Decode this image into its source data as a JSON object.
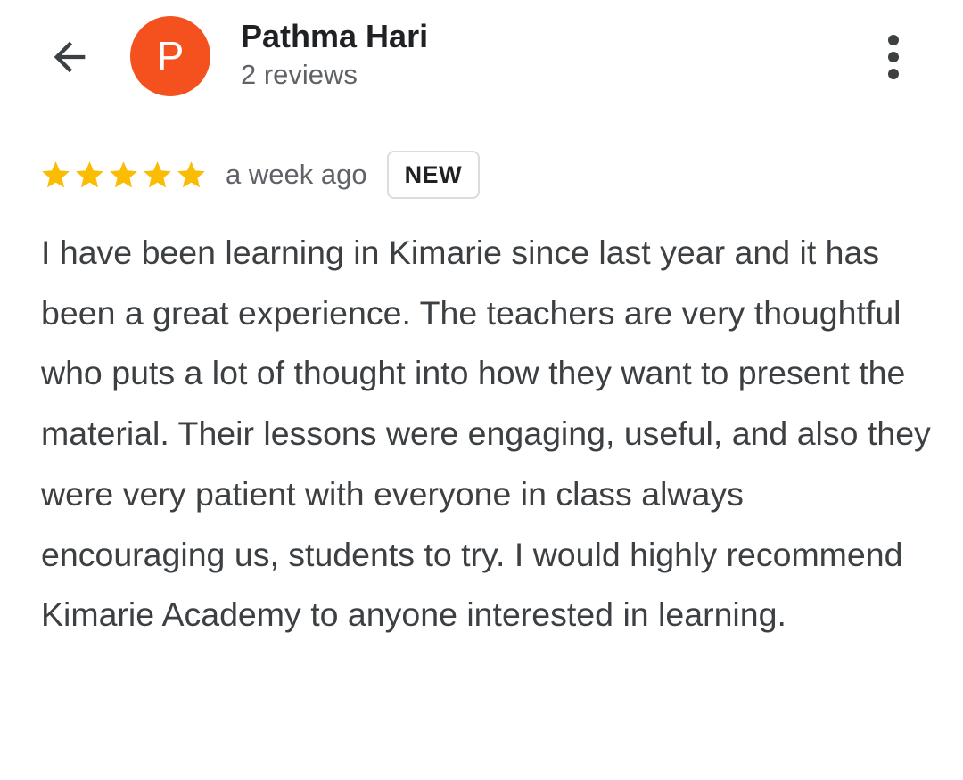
{
  "header": {
    "back_icon": "arrow-left-icon",
    "avatar": {
      "initial": "P",
      "color": "#f4511e"
    },
    "name": "Pathma Hari",
    "review_count": "2 reviews",
    "more_icon": "more-vert-icon"
  },
  "review": {
    "rating": 5,
    "rating_max": 5,
    "star_color": "#fbbc04",
    "time": "a week ago",
    "badge": "NEW",
    "text": "I have been learning in Kimarie since last year and it has been a great experience. The teachers are very thoughtful who puts a lot of thought into how they want to present the material. Their lessons were engaging, useful, and also they were very patient with everyone in class always encouraging us, students to try. I would highly recommend Kimarie Academy to anyone interested in learning."
  }
}
